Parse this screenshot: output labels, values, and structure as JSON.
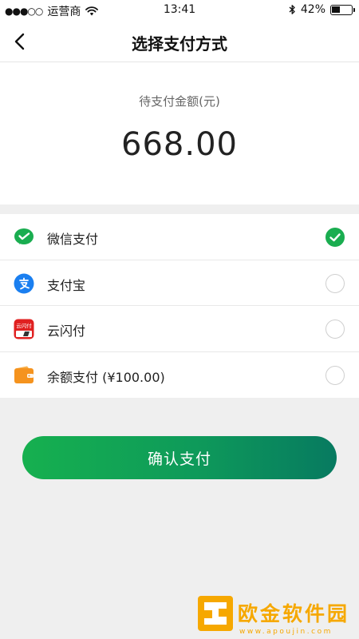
{
  "status_bar": {
    "signal_dots": "●●●○○",
    "carrier": "运营商",
    "time": "13:41",
    "battery_percent": "42%",
    "battery_level": 0.42
  },
  "nav": {
    "title": "选择支付方式"
  },
  "amount": {
    "label": "待支付金额(元)",
    "value": "668.00"
  },
  "payment_methods": [
    {
      "label": "微信支付",
      "icon": "wechat-pay-icon",
      "selected": true,
      "color": "#1aad50"
    },
    {
      "label": "支付宝",
      "icon": "alipay-icon",
      "selected": false,
      "color": "#1a7ff0"
    },
    {
      "label": "云闪付",
      "icon": "unionpay-quickpass-icon",
      "selected": false,
      "color": "#e02020",
      "icon_text": "云闪付"
    },
    {
      "label": "余额支付 (¥100.00)",
      "icon": "wallet-icon",
      "selected": false,
      "color": "#f5931e"
    }
  ],
  "confirm_button": {
    "label": "确认支付"
  },
  "watermark": {
    "text": "欧金软件园",
    "url": "www.apoujin.com"
  },
  "colors": {
    "accent_green": "#1aad50",
    "button_gradient_end": "#077a60",
    "watermark_orange": "#f6a800"
  }
}
